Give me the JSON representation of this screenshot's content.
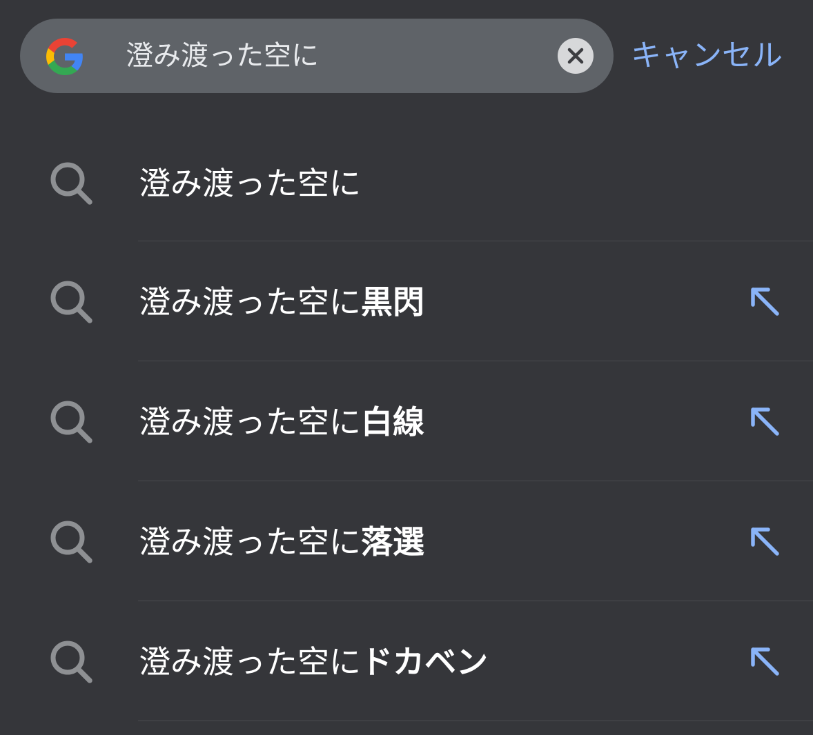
{
  "search": {
    "query": "澄み渡った空に",
    "cancel_label": "キャンセル",
    "logo_icon": "google-g-icon",
    "clear_icon": "clear-x-icon"
  },
  "colors": {
    "background": "#35363a",
    "search_bar": "#5f6368",
    "accent": "#8ab4f8",
    "text": "#ffffff",
    "icon": "#8e9093"
  },
  "suggestions": [
    {
      "prefix": "澄み渡った空に",
      "completion": "",
      "icon": "search-icon",
      "has_fill_arrow": false
    },
    {
      "prefix": "澄み渡った空に",
      "completion": "黒閃",
      "icon": "search-icon",
      "has_fill_arrow": true
    },
    {
      "prefix": "澄み渡った空に",
      "completion": "白線",
      "icon": "search-icon",
      "has_fill_arrow": true
    },
    {
      "prefix": "澄み渡った空に",
      "completion": "落選",
      "icon": "search-icon",
      "has_fill_arrow": true
    },
    {
      "prefix": "澄み渡った空に",
      "completion": "ドカベン",
      "icon": "search-icon",
      "has_fill_arrow": true
    }
  ]
}
